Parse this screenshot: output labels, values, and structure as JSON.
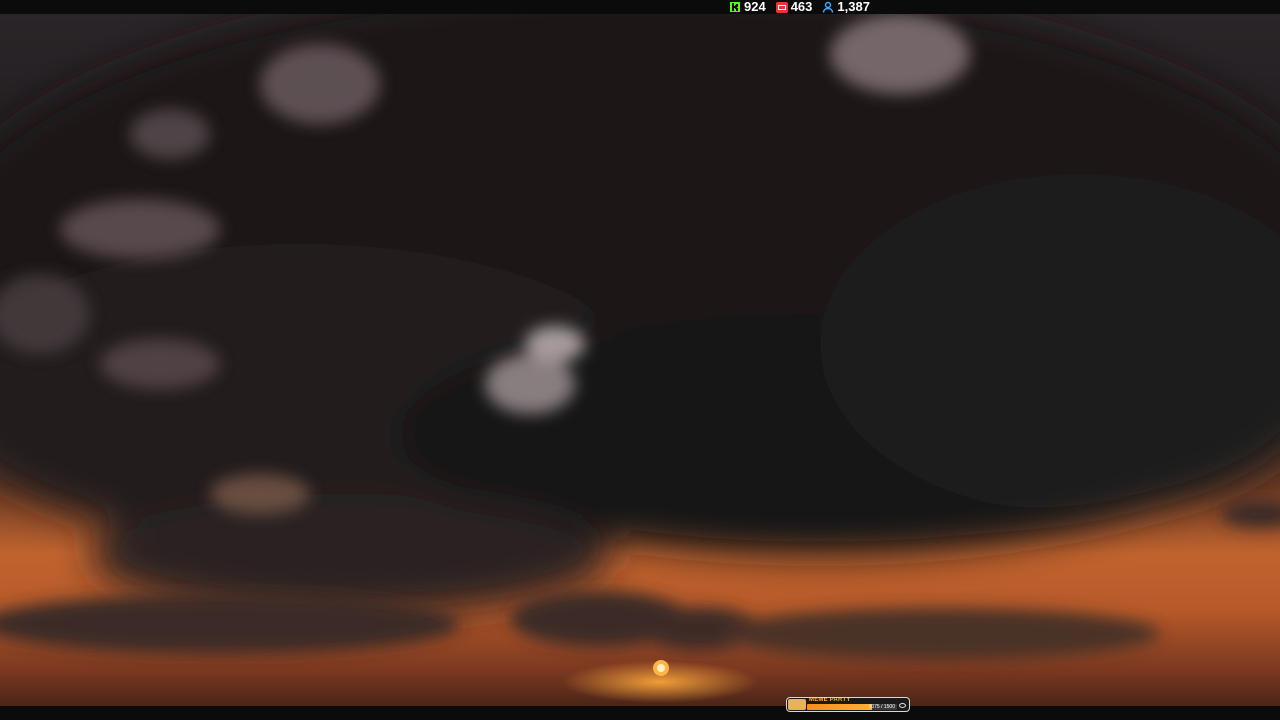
{
  "header": {
    "stats": [
      {
        "icon": "kick-icon",
        "value": "924",
        "color": "#53fc18"
      },
      {
        "icon": "live-icon",
        "value": "463",
        "color": "#ff3b3b"
      },
      {
        "icon": "viewers-icon",
        "value": "1,387",
        "color": "#3da9ff"
      }
    ]
  },
  "widget": {
    "title": "MEME PARTY",
    "progress_text": "1075 / 1500",
    "progress_fraction": 0.717,
    "accent": "#ff9a1f"
  },
  "scene": {
    "description_colors": {
      "clouds": "#1d1a1c",
      "sky_glow": "#c0632e",
      "sun": "#ffb347"
    }
  }
}
